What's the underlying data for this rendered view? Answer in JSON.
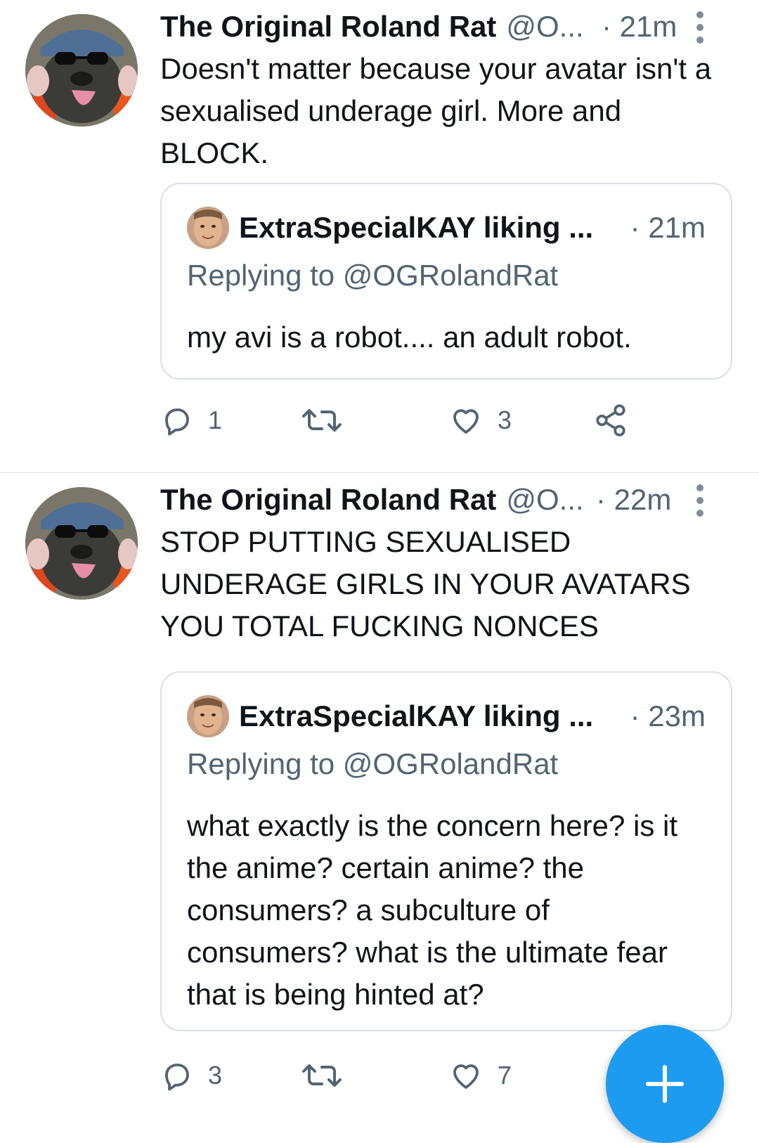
{
  "tweets": [
    {
      "author_name": "The Original Roland Rat",
      "handle": "@O...",
      "time": "· 21m",
      "text": "Doesn't matter because your avatar isn't a sexualised underage girl. More and BLOCK.",
      "quote": {
        "name": "ExtraSpecialKAY liking ...",
        "time": "· 21m",
        "replying": "Replying to @OGRolandRat",
        "text": "my avi is a robot.... an adult robot."
      },
      "actions": {
        "replies": "1",
        "likes": "3"
      }
    },
    {
      "author_name": "The Original Roland Rat",
      "handle": "@O...",
      "time": "· 22m",
      "text": "STOP PUTTING SEXUALISED UNDERAGE GIRLS IN YOUR AVATARS YOU TOTAL FUCKING NONCES",
      "quote": {
        "name": "ExtraSpecialKAY liking ...",
        "time": "· 23m",
        "replying": "Replying to @OGRolandRat",
        "text": "what exactly is the concern here? is it the anime? certain anime? the consumers? a subculture of consumers? what is the ultimate fear that is being hinted at?"
      },
      "actions": {
        "replies": "3",
        "likes": "7"
      }
    }
  ],
  "icons": {
    "reply": "reply-icon",
    "retweet": "retweet-icon",
    "like": "heart-icon",
    "share": "share-icon",
    "more": "more-vertical-icon",
    "compose": "plus-icon"
  },
  "colors": {
    "accent": "#1d9bf0",
    "secondary_text": "#536471",
    "border": "#d9dfe3"
  }
}
